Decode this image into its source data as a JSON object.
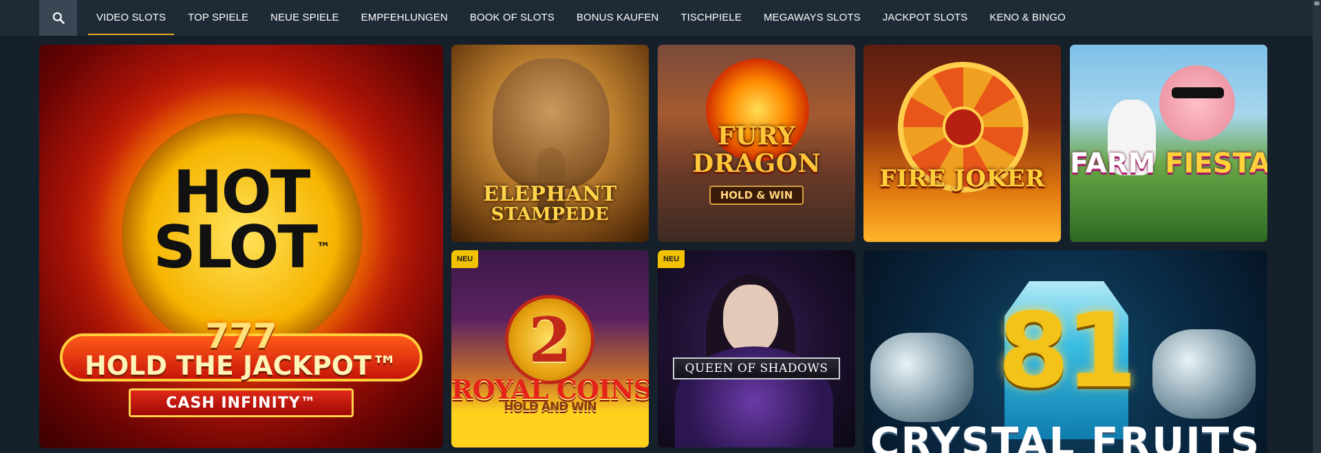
{
  "nav": {
    "search_icon": "search-icon",
    "tabs": [
      {
        "label": "VIDEO SLOTS",
        "active": true
      },
      {
        "label": "TOP SPIELE",
        "active": false
      },
      {
        "label": "NEUE SPIELE",
        "active": false
      },
      {
        "label": "EMPFEHLUNGEN",
        "active": false
      },
      {
        "label": "BOOK OF SLOTS",
        "active": false
      },
      {
        "label": "BONUS KAUFEN",
        "active": false
      },
      {
        "label": "TISCHPIELE",
        "active": false
      },
      {
        "label": "MEGAWAYS SLOTS",
        "active": false
      },
      {
        "label": "JACKPOT SLOTS",
        "active": false
      },
      {
        "label": "KENO & BINGO",
        "active": false
      }
    ],
    "active_color": "#e9a825"
  },
  "games": {
    "hot_slot": {
      "line1": "HOT",
      "line2": "SLOT",
      "tm": "™",
      "number": "777",
      "hold": "HOLD THE JACKPOT™",
      "cash": "CASH INFINITY™"
    },
    "elephant": {
      "line1": "ELEPHANT",
      "line2": "STAMPEDE"
    },
    "fury_dragon": {
      "line1": "FURY",
      "line2": "DRAGON",
      "badge": "HOLD & WIN"
    },
    "fire_joker": {
      "title": "FIRE JOKER"
    },
    "farm_fiesta": {
      "word1": "FARM ",
      "word2": "FIESTA"
    },
    "royal_coins": {
      "number": "2",
      "title": "ROYAL COINS",
      "subtitle": "HOLD AND WIN",
      "badge": "NEU"
    },
    "queen": {
      "title": "QUEEN OF SHADOWS",
      "badge": "NEU"
    },
    "crystal_fruits": {
      "number": "81",
      "title": "CRYSTAL FRUITS"
    }
  },
  "colors": {
    "background": "#16202b",
    "nav_bg": "#1e2a36",
    "badge": "#f2c200"
  }
}
